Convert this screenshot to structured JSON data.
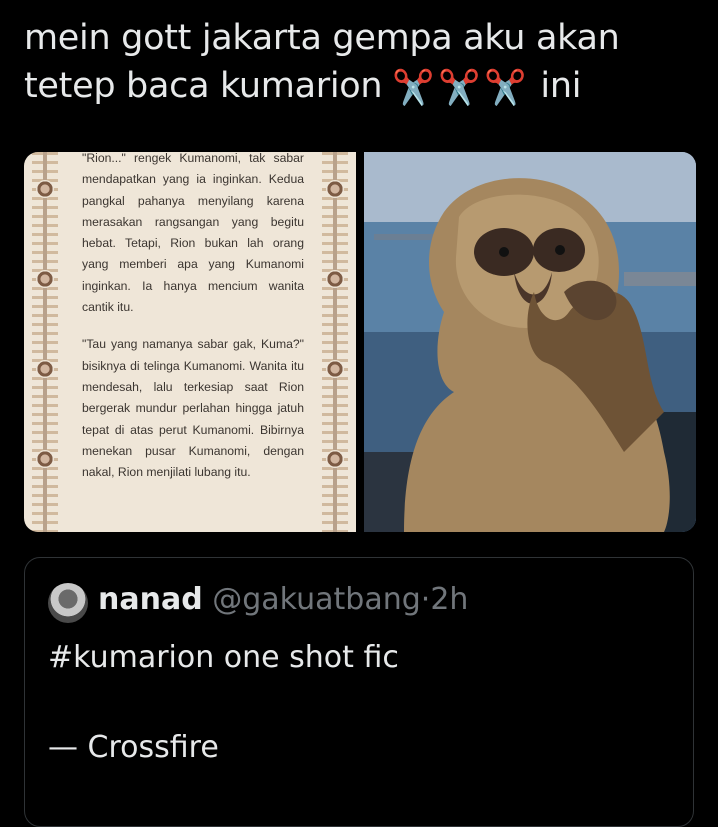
{
  "tweet": {
    "line1": "mein gott jakarta gempa aku akan",
    "line2_prefix": "tetep baca kumarion",
    "line2_suffix": "ini",
    "emoji": "✂️",
    "emoji_count": 3,
    "emoji_color": "#c9302c"
  },
  "media": {
    "left_image": {
      "description_icon": "book-page-image",
      "paragraph1": "\"Rion...\" rengek Kumanomi, tak sabar mendapatkan yang ia inginkan. Kedua pangkal pahanya menyilang karena merasakan rangsangan yang begitu hebat. Tetapi, Rion bukan lah orang yang memberi apa yang Kumanomi inginkan. Ia hanya mencium wanita cantik itu.",
      "paragraph2": "\"Tau yang namanya sabar gak, Kuma?\" bisiknya di telinga Kumanomi. Wanita itu mendesah, lalu terkesiap saat Rion bergerak mundur perlahan hingga jatuh tepat di atas perut Kumanomi. Bibirnya menekan pusar Kumanomi, dengan nakal, Rion menjilati lubang itu."
    },
    "right_image": {
      "description_icon": "monkey-photo"
    }
  },
  "quoted_tweet": {
    "name": "nanad",
    "handle": "@gakuatbang",
    "dot": "·",
    "time": "2h",
    "text": "#kumarion one shot fic",
    "text2": "— Crossfire"
  },
  "colors": {
    "background": "#000000",
    "text_primary": "#e7e9ea",
    "text_secondary": "#71767b",
    "border": "#2f3336"
  }
}
